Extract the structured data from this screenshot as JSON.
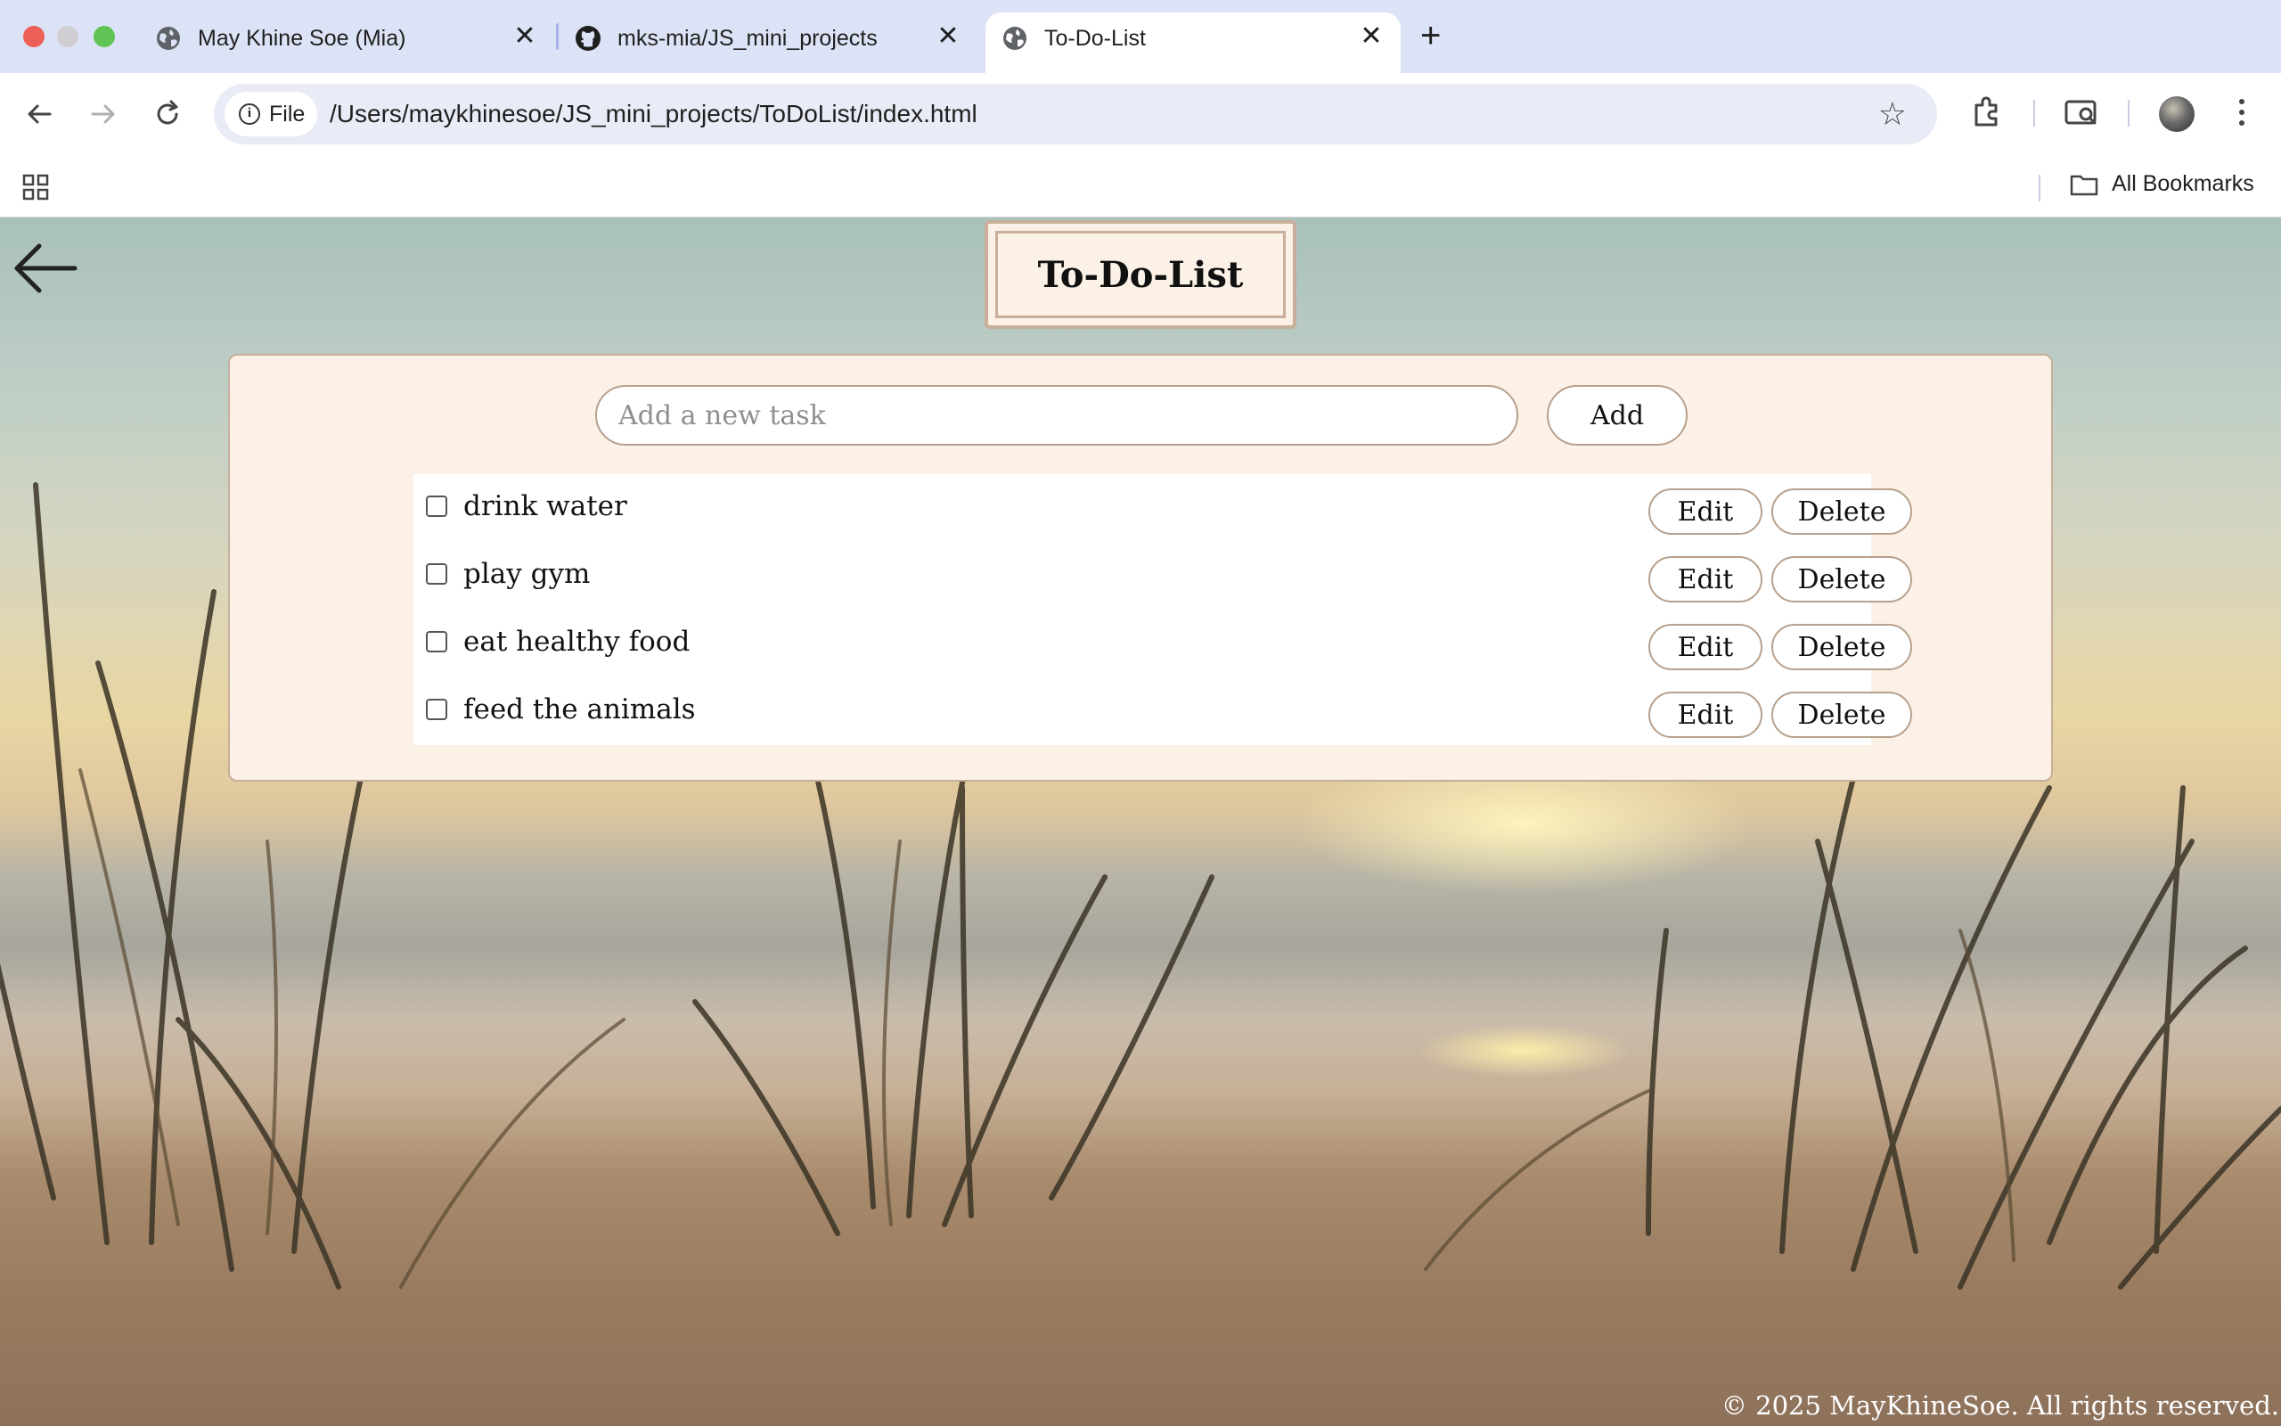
{
  "browser": {
    "tabs": [
      {
        "label": "May Khine Soe (Mia)",
        "favicon": "globe-icon"
      },
      {
        "label": "mks-mia/JS_mini_projects",
        "favicon": "github-icon"
      },
      {
        "label": "To-Do-List",
        "favicon": "globe-icon",
        "active": true
      }
    ],
    "new_tab": "+",
    "close_glyph": "✕",
    "url_chip": "File",
    "url": "/Users/maykhinesoe/JS_mini_projects/ToDoList/index.html",
    "bookmarks_label": "All Bookmarks"
  },
  "page": {
    "title": "To-Do-List",
    "input_placeholder": "Add a new task",
    "input_value": "",
    "add_label": "Add",
    "tasks": [
      {
        "text": "drink water",
        "checked": false
      },
      {
        "text": "play gym",
        "checked": false
      },
      {
        "text": "eat healthy food",
        "checked": false
      },
      {
        "text": "feed the animals",
        "checked": false
      }
    ],
    "edit_label": "Edit",
    "delete_label": "Delete",
    "footer": "© 2025 MayKhineSoe. All rights reserved."
  },
  "colors": {
    "tabstrip": "#dde3f6",
    "card_bg": "#fbf1e7",
    "border": "#c6ae9b"
  }
}
